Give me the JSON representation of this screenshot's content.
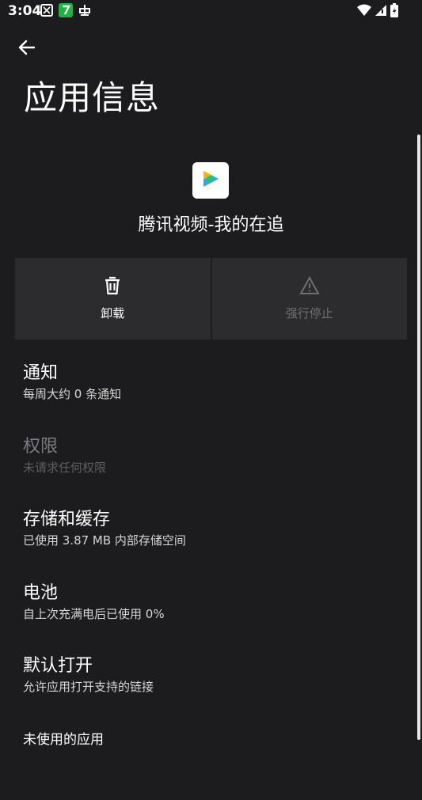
{
  "status": {
    "time": "3:04",
    "left_icons": [
      "notification-icon-1",
      "notification-icon-2",
      "notification-icon-3"
    ],
    "right_icons": [
      "wifi-icon",
      "signal-icon",
      "battery-icon"
    ]
  },
  "header": {
    "back_icon": "arrow-left-icon",
    "title": "应用信息"
  },
  "app": {
    "name": "腾讯视频-我的在追",
    "icon": "tencent-video-icon"
  },
  "actions": {
    "uninstall_label": "卸载",
    "force_stop_label": "强行停止"
  },
  "items": [
    {
      "title": "通知",
      "sub": "每周大约 0 条通知"
    },
    {
      "title": "权限",
      "sub": "未请求任何权限"
    },
    {
      "title": "存储和缓存",
      "sub": "已使用 3.87 MB 内部存储空间"
    },
    {
      "title": "电池",
      "sub": "自上次充满电后已使用 0%"
    },
    {
      "title": "默认打开",
      "sub": "允许应用打开支持的链接"
    },
    {
      "title": "未使用的应用",
      "sub": ""
    }
  ],
  "colors": {
    "background": "#1c1c1e",
    "card": "#2c2c2f",
    "disabled_text": "#7c7c80"
  }
}
